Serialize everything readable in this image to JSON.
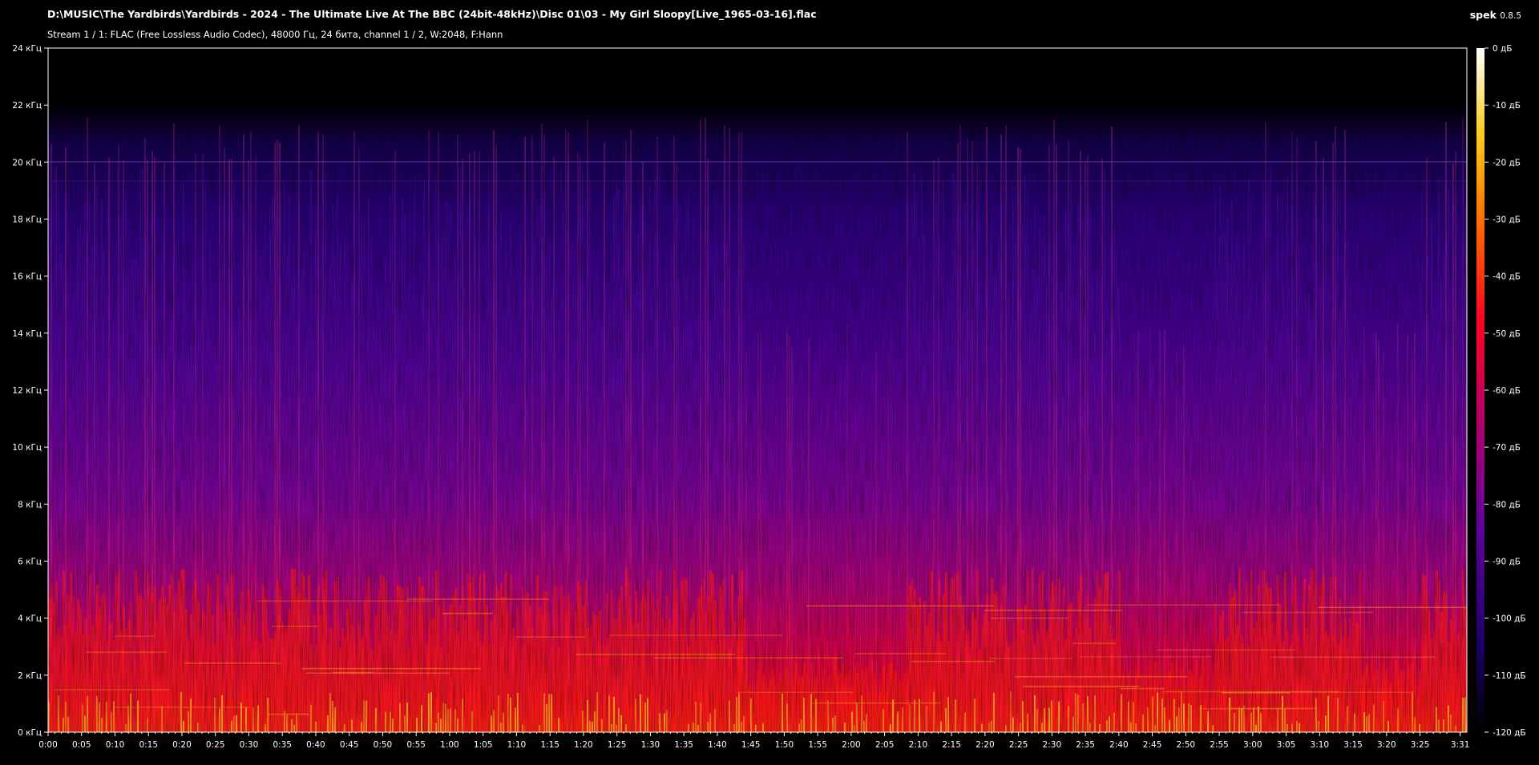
{
  "window": {
    "title": "D:\\MUSIC\\The Yardbirds\\Yardbirds - 2024 - The Ultimate Live At The BBC (24bit-48kHz)\\Disc 01\\03 - My Girl Sloopy[Live_1965-03-16].flac",
    "subtitle": "Stream 1 / 1: FLAC (Free Lossless Audio Codec), 48000 Гц, 24 бита, channel 1 / 2, W:2048, F:Hann",
    "app_name": "spek",
    "app_version": "0.8.5"
  },
  "chart_data": {
    "type": "heatmap",
    "y_axis": {
      "range": [
        0,
        24
      ],
      "tick_labels": [
        "0 кГц",
        "2 кГц",
        "4 кГц",
        "6 кГц",
        "8 кГц",
        "10 кГц",
        "12 кГц",
        "14 кГц",
        "16 кГц",
        "18 кГц",
        "20 кГц",
        "22 кГц",
        "24 кГц"
      ],
      "tick_values": [
        0,
        2,
        4,
        6,
        8,
        10,
        12,
        14,
        16,
        18,
        20,
        22,
        24
      ]
    },
    "x_axis": {
      "range": [
        0,
        212
      ],
      "tick_labels": [
        "0:00",
        "0:05",
        "0:10",
        "0:15",
        "0:20",
        "0:25",
        "0:30",
        "0:35",
        "0:40",
        "0:45",
        "0:50",
        "0:55",
        "1:00",
        "1:05",
        "1:10",
        "1:15",
        "1:20",
        "1:25",
        "1:30",
        "1:35",
        "1:40",
        "1:45",
        "1:50",
        "1:55",
        "2:00",
        "2:05",
        "2:10",
        "2:15",
        "2:20",
        "2:25",
        "2:30",
        "2:35",
        "2:40",
        "2:45",
        "2:50",
        "2:55",
        "3:00",
        "3:05",
        "3:10",
        "3:15",
        "3:20",
        "3:25",
        "3:31"
      ],
      "tick_values": [
        0,
        5,
        10,
        15,
        20,
        25,
        30,
        35,
        40,
        45,
        50,
        55,
        60,
        65,
        70,
        75,
        80,
        85,
        90,
        95,
        100,
        105,
        110,
        115,
        120,
        125,
        130,
        135,
        140,
        145,
        150,
        155,
        160,
        165,
        170,
        175,
        180,
        185,
        190,
        195,
        200,
        205,
        211
      ]
    },
    "colorbar": {
      "range": [
        -120,
        0
      ],
      "tick_labels": [
        "0 дБ",
        "-10 дБ",
        "-20 дБ",
        "-30 дБ",
        "-40 дБ",
        "-50 дБ",
        "-60 дБ",
        "-70 дБ",
        "-80 дБ",
        "-90 дБ",
        "-100 дБ",
        "-110 дБ",
        "-120 дБ"
      ],
      "tick_values": [
        0,
        -10,
        -20,
        -30,
        -40,
        -50,
        -60,
        -70,
        -80,
        -90,
        -100,
        -110,
        -120
      ],
      "colors": [
        "#000000",
        "#1a0064",
        "#60009c",
        "#b0006e",
        "#ff0020",
        "#ff7000",
        "#ffd020",
        "#ffffff"
      ]
    }
  }
}
